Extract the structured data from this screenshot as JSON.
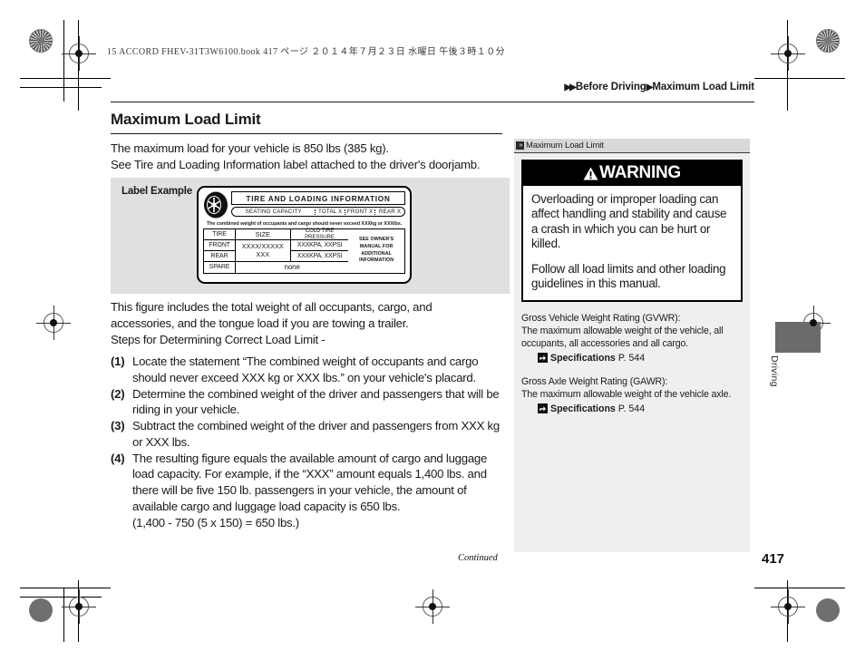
{
  "print": {
    "book_header": "15 ACCORD FHEV-31T3W6100.book   417 ページ   ２０１４年７月２３日   水曜日   午後３時１０分"
  },
  "breadcrumb": {
    "arrows": "▶▶",
    "parent": "Before Driving",
    "separator": "▶",
    "current": "Maximum Load Limit"
  },
  "main": {
    "title": "Maximum Load Limit",
    "intro_line1": "The maximum load for your vehicle is 850 lbs (385 kg).",
    "intro_line2": "See Tire and Loading Information label attached to the driver's doorjamb.",
    "body_line1": "This figure includes the total weight of all occupants, cargo, and",
    "body_line2": "accessories, and the tongue load if you are towing a trailer.",
    "body_line3": "Steps for Determining Correct Load Limit -",
    "steps": [
      {
        "num": "(1)",
        "text": "Locate the statement “The combined weight of occupants and cargo should never exceed XXX kg or XXX lbs.” on your vehicle's placard."
      },
      {
        "num": "(2)",
        "text": "Determine the combined weight of the driver and passengers that will be riding in your vehicle."
      },
      {
        "num": "(3)",
        "text": "Subtract the combined weight of the driver and passengers from XXX kg or XXX lbs."
      },
      {
        "num": "(4)",
        "text": "The resulting figure equals the available amount of cargo and luggage load capacity. For example, if the “XXX” amount equals 1,400 lbs. and there will be five 150 lb. passengers in your vehicle, the amount of available cargo and luggage load capacity is 650 lbs."
      }
    ],
    "step4_formula": "(1,400 - 750 (5 x 150) = 650 lbs.)",
    "continued": "Continued"
  },
  "figure": {
    "caption": "Label Example",
    "label": {
      "title": "TIRE  AND  LOADING   INFORMATION",
      "seating_capacity": "SEATING CAPACITY",
      "seating_total": "TOTAL  X",
      "seating_front": "FRONT X",
      "seating_rear": "REAR  X",
      "note": "The combined weight of occupants and cargo should never  exceed XXXkg or XXXlbs.",
      "headers": {
        "tire": "TIRE",
        "size": "SIZE",
        "pressure": "COLD TIRE PRESSURE"
      },
      "rows": [
        {
          "label": "FRONT",
          "size": "XXXX/XXXXX  XXX",
          "pressure": "XXXKPA, XXPSI"
        },
        {
          "label": "REAR",
          "pressure": "XXXKPA, XXPSI"
        },
        {
          "label": "SPARE",
          "value": "none"
        }
      ],
      "owner_note": "SEE  OWNER'S MANUAL  FOR ADDITIONAL INFORMATION"
    }
  },
  "sidebar": {
    "header": "Maximum Load Limit",
    "warning": {
      "heading": "WARNING",
      "paragraph1": "Overloading or improper loading can affect handling and stability and cause a crash in which you can be hurt or killed.",
      "paragraph2": "Follow all load limits and other loading guidelines in this manual."
    },
    "notes": [
      {
        "title": "Gross Vehicle Weight Rating (GVWR):",
        "desc": "The maximum allowable weight of the vehicle, all occupants, all accessories and all cargo.",
        "ref_label": "Specifications",
        "ref_page": "P. 544"
      },
      {
        "title": "Gross Axle Weight Rating (GAWR):",
        "desc": "The maximum allowable weight of the vehicle axle.",
        "ref_label": "Specifications",
        "ref_page": "P. 544"
      }
    ]
  },
  "thumb_tab": {
    "label": "Driving"
  },
  "page_number": "417"
}
